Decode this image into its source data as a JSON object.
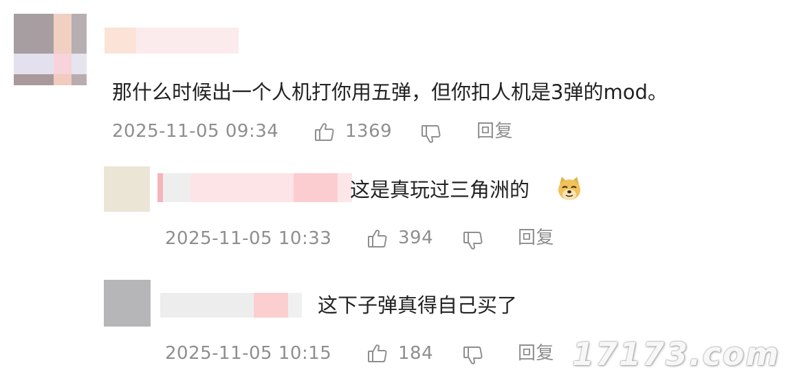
{
  "comments": [
    {
      "text": "那什么时候出一个人机打你用五弹，但你扣人机是3弹的mod。",
      "time": "2025-11-05 09:34",
      "likes": "1369",
      "reply_label": "回复",
      "like_icon": "thumbs-up-icon",
      "dislike_icon": "thumbs-down-icon"
    },
    {
      "text": "这是真玩过三角洲的",
      "emoji": "doge-emoji",
      "time": "2025-11-05 10:33",
      "likes": "394",
      "reply_label": "回复"
    },
    {
      "text": "这下子弹真得自己买了",
      "time": "2025-11-05 10:15",
      "likes": "184",
      "reply_label": "回复"
    }
  ],
  "watermark": "17173.com",
  "colors": {
    "meta_gray": "#8e8e8e",
    "text": "#222222"
  }
}
